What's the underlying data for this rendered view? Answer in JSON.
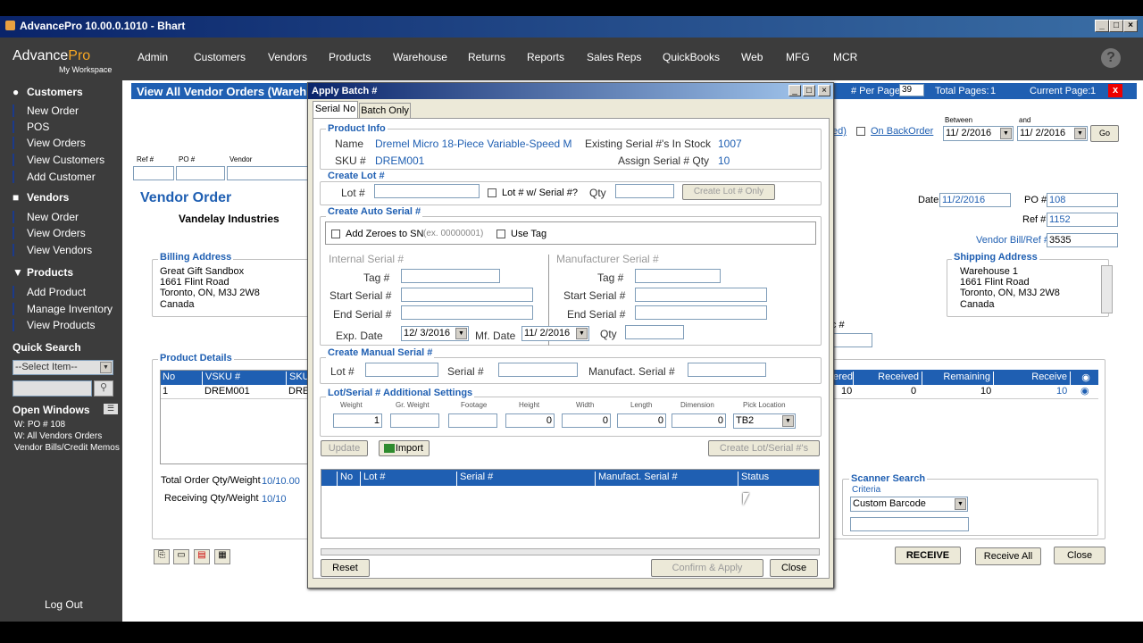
{
  "window": {
    "title": "AdvancePro 10.00.0.1010 - Bhart"
  },
  "logo": {
    "name": "AdvancePro",
    "brand_part": "Pro",
    "workspace": "My Workspace"
  },
  "menu": [
    "Admin",
    "Customers",
    "Vendors",
    "Products",
    "Warehouse",
    "Returns",
    "Reports",
    "Sales Reps",
    "QuickBooks",
    "Web",
    "MFG",
    "MCR"
  ],
  "sidebar": {
    "customers": {
      "title": "Customers",
      "items": [
        "New Order",
        "POS",
        "View Orders",
        "View Customers",
        "Add Customer"
      ]
    },
    "vendors": {
      "title": "Vendors",
      "items": [
        "New Order",
        "View Orders",
        "View Vendors"
      ]
    },
    "products": {
      "title": "Products",
      "items": [
        "Add Product",
        "Manage Inventory",
        "View Products"
      ]
    },
    "quick_search": {
      "title": "Quick Search",
      "select": "--Select Item--"
    },
    "open_windows": {
      "title": "Open Windows",
      "items": [
        "W: PO # 108",
        "W: All Vendors Orders",
        "Vendor Bills/Credit Memos"
      ]
    },
    "logout": "Log Out"
  },
  "page": {
    "header": "View All Vendor Orders  (Wareh",
    "per_page_label": "# Per Page",
    "per_page": "39",
    "total_pages_label": "Total Pages:",
    "total_pages": "1",
    "current_page_label": "Current Page:",
    "current_page": "1",
    "close_x": "x",
    "filter_ref": "Ref #",
    "filter_po": "PO #",
    "filter_vendor": "Vendor",
    "filter_link": "ed)",
    "backorder_label": "On BackOrder",
    "between": "Between",
    "and": "and",
    "date_from": "11/ 2/2016",
    "date_to": "11/ 2/2016",
    "go": "Go"
  },
  "vendor_order": {
    "title": "Vendor Order",
    "vendor": "Vandelay Industries",
    "billing_label": "Billing Address",
    "billing": [
      "Great Gift Sandbox",
      "1661 Flint Road",
      "Toronto, ON, M3J 2W8",
      "Canada"
    ],
    "shipping_label": "Shipping Address",
    "shipping": [
      "Warehouse 1",
      "1661 Flint Road",
      "Toronto, ON, M3J 2W8",
      "Canada"
    ],
    "date_label": "Date",
    "date": "11/2/2016",
    "po_label": "PO #",
    "po": "108",
    "ref_label": "Ref #",
    "ref": "1152",
    "bill_label": "Vendor Bill/Ref #",
    "bill": "3535",
    "c_label": "c #"
  },
  "product_details": {
    "title": "Product Details",
    "columns": [
      "No",
      "VSKU #",
      "SKU"
    ],
    "row": {
      "no": "1",
      "vsku": "DREM001",
      "sku": "DRE"
    },
    "right_columns": [
      "ered",
      "Received",
      "Remaining",
      "Receive"
    ],
    "right_row": {
      "ordered": "10",
      "received": "0",
      "remaining": "10",
      "receive": "10"
    },
    "total_label": "Total Order Qty/Weight",
    "total": "10/10.00",
    "receiving_label": "Receiving Qty/Weight",
    "receiving": "10/10"
  },
  "scanner": {
    "title": "Scanner Search",
    "criteria_label": "Criteria",
    "criteria": "Custom Barcode"
  },
  "buttons": {
    "receive": "RECEIVE",
    "receive_all": "Receive All",
    "close": "Close"
  },
  "dialog": {
    "title": "Apply Batch #",
    "tabs": [
      "Serial No",
      "Batch Only"
    ],
    "product_info": {
      "title": "Product Info",
      "name_label": "Name",
      "name": "Dremel Micro 18-Piece Variable-Speed M",
      "sku_label": "SKU #",
      "sku": "DREM001",
      "existing_label": "Existing Serial #'s In Stock",
      "existing": "1007",
      "assign_label": "Assign Serial # Qty",
      "assign": "10"
    },
    "create_lot": {
      "title": "Create Lot #",
      "lot_label": "Lot #",
      "lot_w_serial": "Lot # w/ Serial #?",
      "qty_label": "Qty",
      "button": "Create Lot # Only"
    },
    "auto_serial": {
      "title": "Create Auto Serial #",
      "add_zeroes": "Add Zeroes to SN",
      "example": "(ex. 00000001)",
      "use_tag": "Use Tag",
      "internal_title": "Internal Serial #",
      "manufacturer_title": "Manufacturer Serial #",
      "tag_label": "Tag #",
      "start_label": "Start Serial #",
      "end_label": "End Serial #",
      "exp_label": "Exp. Date",
      "exp": "12/ 3/2016",
      "mfg_label": "Mf. Date",
      "mfg": "11/ 2/2016",
      "qty_label": "Qty"
    },
    "manual_serial": {
      "title": "Create Manual Serial #",
      "lot_label": "Lot #",
      "serial_label": "Serial #",
      "manufact_label": "Manufact. Serial #"
    },
    "additional": {
      "title": "Lot/Serial # Additional Settings",
      "labels": [
        "Weight",
        "Gr. Weight",
        "Footage",
        "Height",
        "Width",
        "Length",
        "Dimension",
        "Pick Location"
      ],
      "values": [
        "1",
        "",
        "",
        "0",
        "0",
        "0",
        "0",
        "TB2"
      ]
    },
    "update": "Update",
    "import": "Import",
    "create_lot_serial": "Create Lot/Serial #'s",
    "grid_columns": [
      "No",
      "Lot #",
      "Serial #",
      "Manufact. Serial #",
      "Status"
    ],
    "reset": "Reset",
    "confirm": "Confirm & Apply",
    "close": "Close"
  }
}
